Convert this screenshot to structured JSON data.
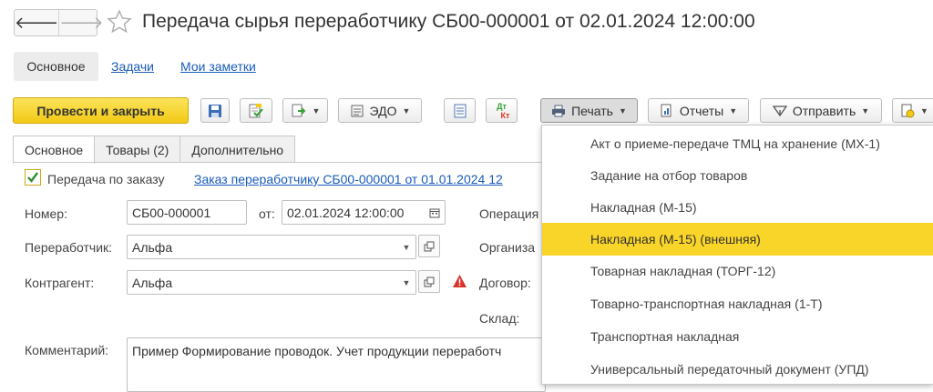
{
  "window": {
    "title": "Передача сырья переработчику СБ00-000001 от 02.01.2024 12:00:00",
    "back_glyph": "🡐",
    "forward_glyph": "🡒"
  },
  "top_tabs": {
    "main": "Основное",
    "tasks": "Задачи",
    "notes": "Мои заметки"
  },
  "toolbar": {
    "post_close": "Провести и закрыть",
    "edo": "ЭДО",
    "print": "Печать",
    "reports": "Отчеты",
    "send": "Отправить",
    "dtkt_top": "Дт",
    "dtkt_bottom": "Кт"
  },
  "form_tabs": [
    "Основное",
    "Товары (2)",
    "Дополнительно"
  ],
  "form": {
    "by_order_label": "Передача по заказу",
    "by_order_checked": true,
    "order_link": "Заказ переработчику СБ00-000001 от 01.01.2024 12",
    "number_label": "Номер:",
    "number_value": "СБ00-000001",
    "date_label": "от:",
    "date_value": "02.01.2024 12:00:00",
    "processor_label": "Переработчик:",
    "processor_value": "Альфа",
    "counterparty_label": "Контрагент:",
    "counterparty_value": "Альфа",
    "operation_label": "Операция",
    "organization_label": "Организа",
    "contract_label": "Договор:",
    "warehouse_label": "Склад:",
    "comment_label": "Комментарий:",
    "comment_value": "Пример Формирование проводок. Учет продукции переработч"
  },
  "print_menu": {
    "items": [
      "Акт о приеме-передаче ТМЦ на хранение (МХ-1)",
      "Задание на отбор товаров",
      "Накладная (М-15)",
      "Накладная (М-15) (внешняя)",
      "Товарная накладная (ТОРГ-12)",
      "Товарно-транспортная накладная (1-Т)",
      "Транспортная накладная",
      "Универсальный передаточный документ (УПД)"
    ],
    "highlighted_index": 3
  },
  "colors": {
    "primary_button": "#f2c915",
    "highlight": "#fad529",
    "link": "#1a5cba",
    "warning": "#d9342b"
  }
}
